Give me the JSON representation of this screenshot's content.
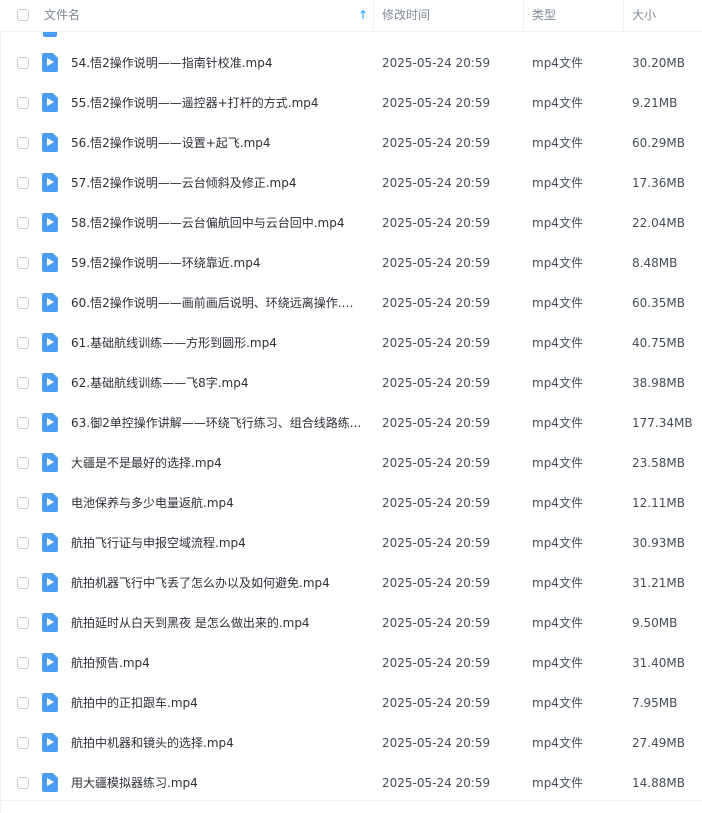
{
  "header": {
    "name_label": "文件名",
    "modified_label": "修改时间",
    "type_label": "类型",
    "size_label": "大小",
    "sort_icon": "arrow-up-icon"
  },
  "colors": {
    "file_icon": "#4a9cf5",
    "sort_accent": "#06a7ff"
  },
  "rows": [
    {
      "name": "54.悟2操作说明——指南针校准.mp4",
      "modified": "2025-05-24 20:59",
      "type": "mp4文件",
      "size": "30.20MB"
    },
    {
      "name": "55.悟2操作说明——遥控器+打杆的方式.mp4",
      "modified": "2025-05-24 20:59",
      "type": "mp4文件",
      "size": "9.21MB"
    },
    {
      "name": "56.悟2操作说明——设置+起飞.mp4",
      "modified": "2025-05-24 20:59",
      "type": "mp4文件",
      "size": "60.29MB"
    },
    {
      "name": "57.悟2操作说明——云台倾斜及修正.mp4",
      "modified": "2025-05-24 20:59",
      "type": "mp4文件",
      "size": "17.36MB"
    },
    {
      "name": "58.悟2操作说明——云台偏航回中与云台回中.mp4",
      "modified": "2025-05-24 20:59",
      "type": "mp4文件",
      "size": "22.04MB"
    },
    {
      "name": "59.悟2操作说明——环绕靠近.mp4",
      "modified": "2025-05-24 20:59",
      "type": "mp4文件",
      "size": "8.48MB"
    },
    {
      "name": "60.悟2操作说明——画前画后说明、环绕远离操作.m...",
      "modified": "2025-05-24 20:59",
      "type": "mp4文件",
      "size": "60.35MB"
    },
    {
      "name": "61.基础航线训练——方形到圆形.mp4",
      "modified": "2025-05-24 20:59",
      "type": "mp4文件",
      "size": "40.75MB"
    },
    {
      "name": "62.基础航线训练——飞8字.mp4",
      "modified": "2025-05-24 20:59",
      "type": "mp4文件",
      "size": "38.98MB"
    },
    {
      "name": "63.御2单控操作讲解——环绕飞行练习、组合线路练...",
      "modified": "2025-05-24 20:59",
      "type": "mp4文件",
      "size": "177.34MB"
    },
    {
      "name": "大疆是不是最好的选择.mp4",
      "modified": "2025-05-24 20:59",
      "type": "mp4文件",
      "size": "23.58MB"
    },
    {
      "name": "电池保养与多少电量返航.mp4",
      "modified": "2025-05-24 20:59",
      "type": "mp4文件",
      "size": "12.11MB"
    },
    {
      "name": "航拍飞行证与申报空域流程.mp4",
      "modified": "2025-05-24 20:59",
      "type": "mp4文件",
      "size": "30.93MB"
    },
    {
      "name": "航拍机器飞行中飞丢了怎么办以及如何避免.mp4",
      "modified": "2025-05-24 20:59",
      "type": "mp4文件",
      "size": "31.21MB"
    },
    {
      "name": "航拍延时从白天到黑夜 是怎么做出来的.mp4",
      "modified": "2025-05-24 20:59",
      "type": "mp4文件",
      "size": "9.50MB"
    },
    {
      "name": "航拍预告.mp4",
      "modified": "2025-05-24 20:59",
      "type": "mp4文件",
      "size": "31.40MB"
    },
    {
      "name": "航拍中的正扣跟车.mp4",
      "modified": "2025-05-24 20:59",
      "type": "mp4文件",
      "size": "7.95MB"
    },
    {
      "name": "航拍中机器和镜头的选择.mp4",
      "modified": "2025-05-24 20:59",
      "type": "mp4文件",
      "size": "27.49MB"
    },
    {
      "name": "用大疆模拟器练习.mp4",
      "modified": "2025-05-24 20:59",
      "type": "mp4文件",
      "size": "14.88MB"
    }
  ]
}
